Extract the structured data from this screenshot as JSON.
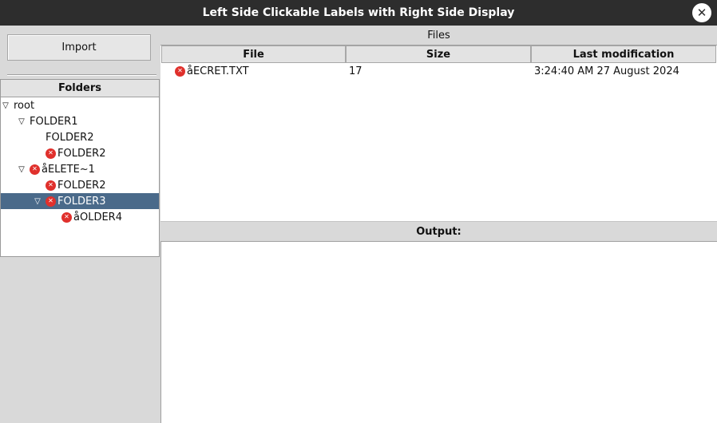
{
  "window": {
    "title": "Left Side Clickable Labels with Right Side Display",
    "close_glyph": "✕"
  },
  "left": {
    "import_label": "Import",
    "tree": {
      "header": "Folders",
      "items": [
        {
          "label": "root",
          "level": 0,
          "expanded": true,
          "error": false,
          "selected": false
        },
        {
          "label": "FOLDER1",
          "level": 1,
          "expanded": true,
          "error": false,
          "selected": false
        },
        {
          "label": "FOLDER2",
          "level": 2,
          "expanded": null,
          "error": false,
          "selected": false
        },
        {
          "label": "FOLDER2",
          "level": 2,
          "expanded": null,
          "error": true,
          "selected": false
        },
        {
          "label": "åELETE~1",
          "level": 1,
          "expanded": true,
          "error": true,
          "selected": false
        },
        {
          "label": "FOLDER2",
          "level": 2,
          "expanded": null,
          "error": true,
          "selected": false
        },
        {
          "label": "FOLDER3",
          "level": 2,
          "expanded": true,
          "error": true,
          "selected": true
        },
        {
          "label": "åOLDER4",
          "level": 3,
          "expanded": null,
          "error": true,
          "selected": false
        }
      ]
    }
  },
  "files": {
    "label": "Files",
    "columns": [
      "File",
      "Size",
      "Last modification"
    ],
    "rows": [
      {
        "name": "åECRET.TXT",
        "size": "17",
        "modified": "3:24:40 AM 27 August 2024",
        "error": true
      }
    ]
  },
  "output": {
    "label": "Output:",
    "text": ""
  },
  "icons": {
    "expand": "triangle-down-icon",
    "error": "error-x-icon"
  },
  "colors": {
    "titlebar": "#2d2d2d",
    "selection": "#4a6a8a",
    "error": "#e0302c"
  }
}
